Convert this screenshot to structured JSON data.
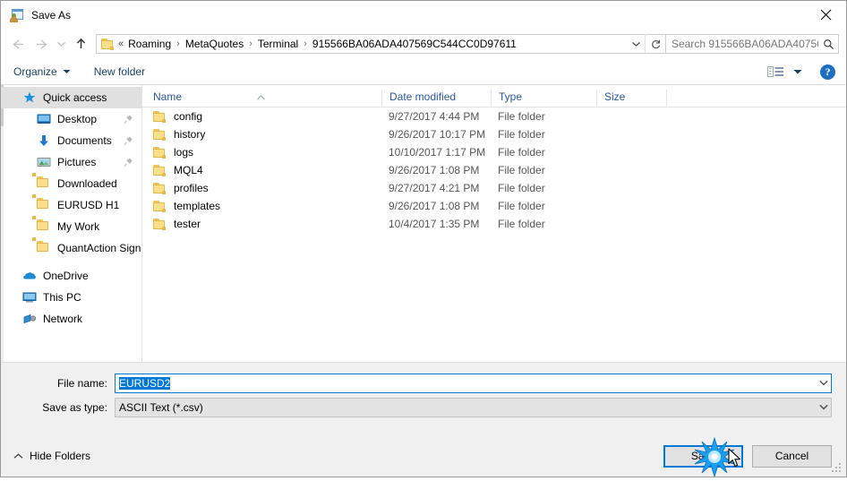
{
  "window": {
    "title": "Save As",
    "icon": "save-as-window-icon",
    "close_label": "✕"
  },
  "nav": {
    "back": "back-arrow",
    "forward": "forward-arrow",
    "recent": "recent-locations-chevron",
    "up": "up-arrow",
    "refresh": "refresh-icon"
  },
  "address": {
    "leading_chevrons": "«",
    "separator": "›",
    "crumbs": [
      "Roaming",
      "MetaQuotes",
      "Terminal",
      "915566BA06ADA407569C544CC0D97611"
    ],
    "dropdown": "chevron-down-icon"
  },
  "search": {
    "placeholder": "Search 915566BA06ADA40756...",
    "icon": "search-icon"
  },
  "toolbar": {
    "organize": "Organize",
    "new_folder": "New folder",
    "view_icon": "details-view-icon",
    "view_caret": "chevron-down-icon",
    "help": "?"
  },
  "sidebar": {
    "items": [
      {
        "label": "Quick access",
        "icon": "star-icon",
        "selected": true,
        "indent": false,
        "pinned": false
      },
      {
        "label": "Desktop",
        "icon": "desktop-icon",
        "selected": false,
        "indent": true,
        "pinned": true
      },
      {
        "label": "Documents",
        "icon": "documents-download-icon",
        "selected": false,
        "indent": true,
        "pinned": true
      },
      {
        "label": "Pictures",
        "icon": "pictures-icon",
        "selected": false,
        "indent": true,
        "pinned": true
      },
      {
        "label": "Downloaded",
        "icon": "folder-icon",
        "selected": false,
        "indent": true,
        "pinned": false
      },
      {
        "label": "EURUSD H1",
        "icon": "folder-icon",
        "selected": false,
        "indent": true,
        "pinned": false
      },
      {
        "label": "My Work",
        "icon": "folder-icon",
        "selected": false,
        "indent": true,
        "pinned": false
      },
      {
        "label": "QuantAction Signal",
        "icon": "folder-icon",
        "selected": false,
        "indent": true,
        "pinned": false
      },
      {
        "label": "OneDrive",
        "icon": "onedrive-cloud-icon",
        "selected": false,
        "indent": false,
        "pinned": false
      },
      {
        "label": "This PC",
        "icon": "this-pc-icon",
        "selected": false,
        "indent": false,
        "pinned": false
      },
      {
        "label": "Network",
        "icon": "network-icon",
        "selected": false,
        "indent": false,
        "pinned": false
      }
    ]
  },
  "filelist": {
    "columns": [
      "Name",
      "Date modified",
      "Type",
      "Size"
    ],
    "sort_column": "Name",
    "sort_direction": "ascending",
    "rows": [
      {
        "name": "config",
        "date": "9/27/2017 4:44 PM",
        "type": "File folder",
        "size": ""
      },
      {
        "name": "history",
        "date": "9/26/2017 10:17 PM",
        "type": "File folder",
        "size": ""
      },
      {
        "name": "logs",
        "date": "10/10/2017 1:17 PM",
        "type": "File folder",
        "size": ""
      },
      {
        "name": "MQL4",
        "date": "9/26/2017 1:08 PM",
        "type": "File folder",
        "size": ""
      },
      {
        "name": "profiles",
        "date": "9/27/2017 4:21 PM",
        "type": "File folder",
        "size": ""
      },
      {
        "name": "templates",
        "date": "9/26/2017 1:08 PM",
        "type": "File folder",
        "size": ""
      },
      {
        "name": "tester",
        "date": "10/4/2017 1:35 PM",
        "type": "File folder",
        "size": ""
      }
    ]
  },
  "form": {
    "filename_label": "File name:",
    "filename_value": "EURUSD2",
    "filename_selected": true,
    "savetype_label": "Save as type:",
    "savetype_value": "ASCII Text (*.csv)",
    "dropdown_icon": "chevron-down-icon"
  },
  "footer": {
    "hide_folders": "Hide Folders",
    "hide_folders_caret": "chevron-up-icon",
    "save": "Save",
    "cancel": "Cancel"
  },
  "overlay": {
    "click_effect": "click-starburst",
    "cursor": "mouse-pointer"
  },
  "colors": {
    "accent": "#0078d7",
    "folder": "#fcdf8a",
    "header_text": "#2b5797",
    "selection": "#0078d7",
    "chrome_bg": "#f0f0f0"
  }
}
